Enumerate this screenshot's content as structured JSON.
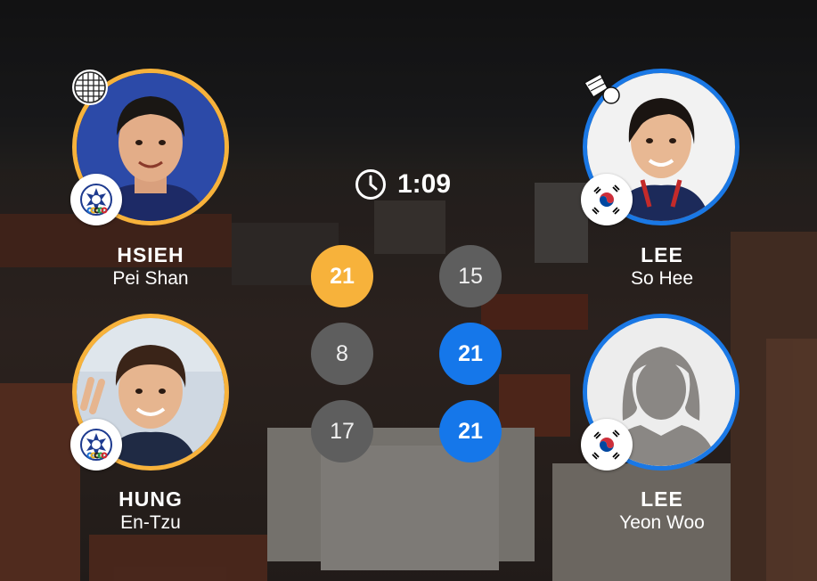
{
  "match": {
    "duration": "1:09"
  },
  "team_left": {
    "color": "#f7b23b",
    "country_flag": "Chinese Taipei flag",
    "players": [
      {
        "surname": "HSIEH",
        "given_name": "Pei Shan"
      },
      {
        "surname": "HUNG",
        "given_name": "En-Tzu"
      }
    ]
  },
  "team_right": {
    "color": "#1a78e5",
    "country_flag": "Korea flag",
    "players": [
      {
        "surname": "LEE",
        "given_name": "So Hee"
      },
      {
        "surname": "LEE",
        "given_name": "Yeon Woo"
      }
    ]
  },
  "games": [
    {
      "left": "21",
      "right": "15",
      "winner": "left"
    },
    {
      "left": "8",
      "right": "21",
      "winner": "right"
    },
    {
      "left": "17",
      "right": "21",
      "winner": "right"
    }
  ],
  "icons": {
    "left_serve_indicator": "racket-icon",
    "right_serve_indicator": "shuttlecock-icon",
    "timer": "clock-icon"
  }
}
